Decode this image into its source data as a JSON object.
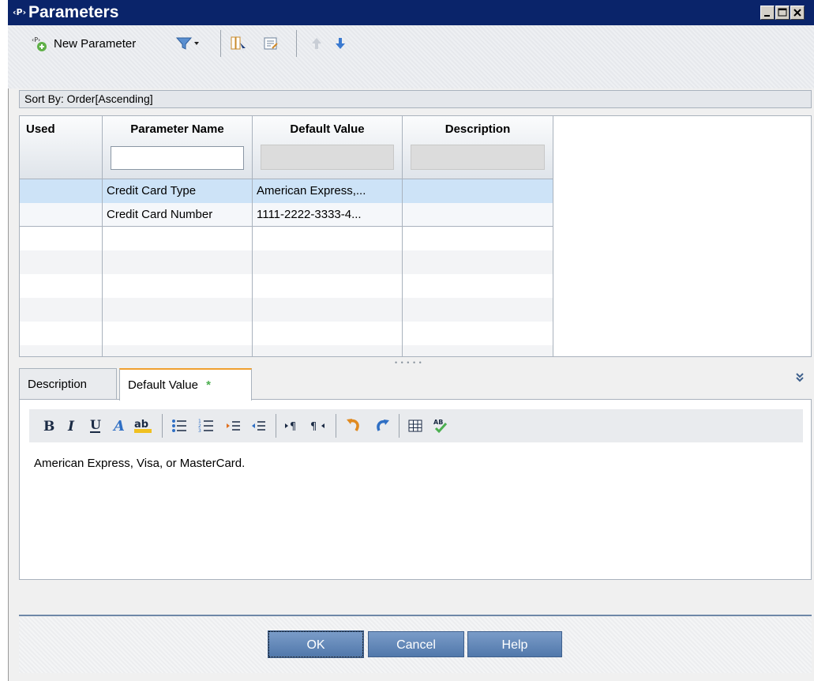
{
  "window": {
    "title": "Parameters"
  },
  "toolbar": {
    "new_parameter_label": "New Parameter"
  },
  "sort": {
    "label": "Sort By: Order[Ascending]"
  },
  "grid": {
    "columns": [
      "Used",
      "Parameter Name",
      "Default Value",
      "Description"
    ],
    "rows": [
      {
        "used": "",
        "name": "Credit Card Type",
        "default": "American Express,...",
        "description": ""
      },
      {
        "used": "",
        "name": "Credit Card Number",
        "default": "1111-2222-3333-4...",
        "description": ""
      }
    ],
    "selected_row": 0
  },
  "tabs": [
    {
      "label": "Description"
    },
    {
      "label": "Default Value",
      "marker": "*"
    }
  ],
  "editor": {
    "text": "American Express, Visa, or MasterCard."
  },
  "buttons": {
    "ok": "OK",
    "cancel": "Cancel",
    "help": "Help"
  },
  "colors": {
    "titlebar": "#0a246a",
    "selected_row": "#cde3f7",
    "button": "#5d84b8",
    "tab_accent": "#f0a030"
  }
}
